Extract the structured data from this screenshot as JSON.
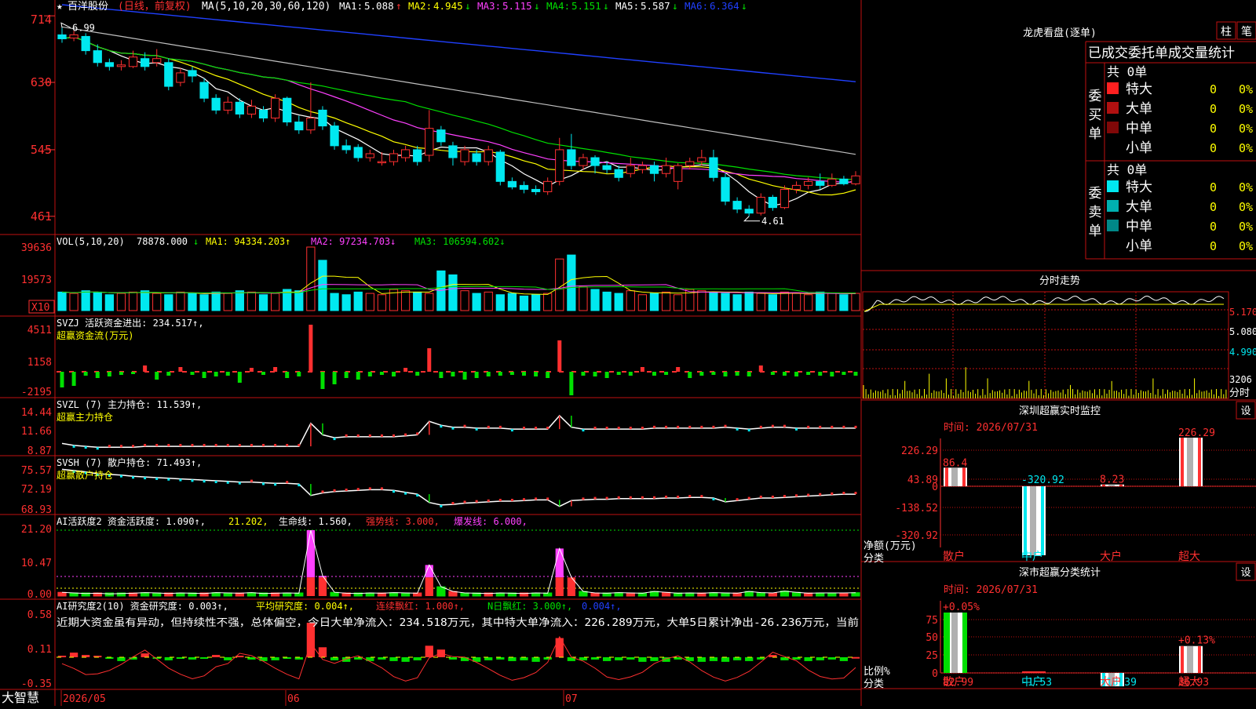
{
  "colors": {
    "bg": "#000000",
    "frame": "#c01010",
    "up": "#ff3030",
    "down": "#00e8f0",
    "ma1": "#ffffff",
    "ma2": "#ffff00",
    "ma3": "#ff40ff",
    "ma4": "#00e000",
    "ma5": "#c0c0c0",
    "ma6": "#2040ff",
    "green": "#00e000",
    "magenta": "#ff40ff",
    "yellow": "#ffff00",
    "text_white": "#ffffff",
    "axis_red": "#ff3030"
  },
  "app": {
    "logo_text": "大智慧",
    "date_axis": {
      "start_label": "2026/05",
      "mid_labels": [
        "06",
        "07"
      ]
    }
  },
  "price_panel": {
    "star": "★",
    "stock_name": "百洋股份",
    "period_label": "(日线，前复权)",
    "ma_prefix": "MA(5,10,20,30,60,120)",
    "ma_values": [
      {
        "label": "MA1:",
        "value": "5.088",
        "arrow": "↑",
        "color": "#ffffff"
      },
      {
        "label": "MA2:",
        "value": "4.945",
        "arrow": "↓",
        "color": "#ffff00"
      },
      {
        "label": "MA3:",
        "value": "5.115",
        "arrow": "↓",
        "color": "#ff40ff"
      },
      {
        "label": "MA4:",
        "value": "5.151",
        "arrow": "↓",
        "color": "#00e000"
      },
      {
        "label": "MA5:",
        "value": "5.587",
        "arrow": "↓",
        "color": "#ffffff"
      },
      {
        "label": "MA6:",
        "value": "6.364",
        "arrow": "↓",
        "color": "#2040ff"
      }
    ],
    "y_ticks": [
      "714",
      "630",
      "545",
      "461"
    ],
    "y_range": [
      4.4,
      7.3
    ],
    "high_marker": "6.99",
    "low_marker": "4.61"
  },
  "vol_panel": {
    "title": "VOL(5,10,20)",
    "main_value": "78878.000",
    "main_arrow": "↓",
    "ma1": "MA1: 94334.203↑",
    "ma2": "MA2: 97234.703↓",
    "ma3": "MA3: 106594.602↓",
    "y_ticks": [
      "39636",
      "19573"
    ],
    "unit": "X10"
  },
  "svzj_panel": {
    "title": "SVZJ  活跃资金进出: 234.517↑,",
    "subtitle": "超赢资金流(万元)",
    "y_ticks": [
      "4511",
      "1158",
      "-2195"
    ]
  },
  "svzl_panel": {
    "title": "SVZL (7) 主力持仓: 11.539↑,",
    "subtitle": "超赢主力持仓",
    "y_ticks": [
      "14.44",
      "11.66",
      "8.87"
    ]
  },
  "svsh_panel": {
    "title": "SVSH (7) 散户持仓: 71.493↑,",
    "subtitle": "超赢散户持仓",
    "y_ticks": [
      "75.57",
      "72.19",
      "68.93"
    ]
  },
  "ai_active_panel": {
    "title": "AI活跃度2 资金活跃度: 1.090↑,",
    "val_21": "21.202,",
    "life_line": "生命线: 1.560,",
    "strong_line": "强势线: 3.000,",
    "burst_line": "爆发线: 6.000,",
    "y_ticks": [
      "21.20",
      "10.47",
      "0.00"
    ]
  },
  "ai_research_panel": {
    "title": "AI研究度2(10) 资金研究度: 0.003↑,",
    "avg": "平均研究度: 0.004↑,",
    "streak": "连续飘红: 1.000↑,",
    "nday": "N日飘红: 3.000↑,",
    "extra": "0.004↑,",
    "comment": "近期大资金虽有异动，但持续性不强，总体偏空，今日大单净流入：234.518万元，其中特大单净流入：226.289万元，大单5日累计净出-26.236万元，当前",
    "y_ticks": [
      "0.58",
      "0.11",
      "-0.35"
    ]
  },
  "chart_data": [
    {
      "type": "candlestick",
      "title": "百洋股份 (日线，前复权)",
      "x_range": [
        "2026/05",
        "2026/07/31"
      ],
      "ylim": [
        4.4,
        7.3
      ],
      "candles": [
        [
          6.9,
          6.85,
          6.99,
          6.8
        ],
        [
          6.86,
          6.9,
          6.95,
          6.82
        ],
        [
          6.88,
          6.7,
          6.92,
          6.65
        ],
        [
          6.7,
          6.55,
          6.78,
          6.5
        ],
        [
          6.55,
          6.5,
          6.6,
          6.45
        ],
        [
          6.5,
          6.52,
          6.58,
          6.45
        ],
        [
          6.5,
          6.62,
          6.7,
          6.48
        ],
        [
          6.6,
          6.5,
          6.68,
          6.45
        ],
        [
          6.55,
          6.6,
          6.72,
          6.5
        ],
        [
          6.55,
          6.25,
          6.6,
          6.2
        ],
        [
          6.3,
          6.42,
          6.48,
          6.25
        ],
        [
          6.45,
          6.38,
          6.5,
          6.3
        ],
        [
          6.3,
          6.1,
          6.35,
          6.05
        ],
        [
          6.1,
          5.95,
          6.15,
          5.9
        ],
        [
          5.95,
          6.05,
          6.12,
          5.9
        ],
        [
          6.05,
          5.9,
          6.1,
          5.85
        ],
        [
          5.9,
          6.0,
          6.08,
          5.85
        ],
        [
          5.95,
          5.85,
          6.0,
          5.8
        ],
        [
          5.85,
          6.1,
          6.15,
          5.8
        ],
        [
          6.1,
          5.8,
          6.12,
          5.75
        ],
        [
          5.8,
          5.7,
          5.88,
          5.65
        ],
        [
          5.7,
          5.85,
          6.3,
          5.65
        ],
        [
          5.95,
          5.75,
          6.0,
          5.7
        ],
        [
          5.75,
          5.5,
          5.8,
          5.45
        ],
        [
          5.5,
          5.45,
          5.58,
          5.4
        ],
        [
          5.48,
          5.35,
          5.52,
          5.3
        ],
        [
          5.35,
          5.4,
          5.45,
          5.3
        ],
        [
          5.3,
          5.3,
          5.42,
          5.25
        ],
        [
          5.3,
          5.4,
          5.45,
          5.25
        ],
        [
          5.35,
          5.45,
          5.5,
          5.3
        ],
        [
          5.45,
          5.3,
          5.5,
          5.25
        ],
        [
          5.38,
          5.72,
          5.95,
          5.3
        ],
        [
          5.7,
          5.55,
          5.75,
          5.5
        ],
        [
          5.5,
          5.35,
          5.55,
          5.25
        ],
        [
          5.3,
          5.45,
          5.5,
          5.25
        ],
        [
          5.4,
          5.3,
          5.45,
          5.25
        ],
        [
          5.3,
          5.45,
          5.5,
          5.25
        ],
        [
          5.42,
          5.05,
          5.45,
          5.0
        ],
        [
          5.05,
          4.98,
          5.1,
          4.95
        ],
        [
          5.0,
          4.95,
          5.05,
          4.9
        ],
        [
          4.95,
          4.92,
          5.0,
          4.88
        ],
        [
          4.92,
          5.05,
          5.1,
          4.88
        ],
        [
          5.05,
          5.45,
          5.6,
          5.0
        ],
        [
          5.45,
          5.25,
          5.65,
          5.2
        ],
        [
          5.25,
          5.35,
          5.4,
          5.2
        ],
        [
          5.35,
          5.25,
          5.38,
          5.15
        ],
        [
          5.25,
          5.2,
          5.3,
          5.15
        ],
        [
          5.2,
          5.1,
          5.25,
          5.05
        ],
        [
          5.15,
          5.25,
          5.35,
          5.1
        ],
        [
          5.2,
          5.25,
          5.3,
          5.15
        ],
        [
          5.25,
          5.15,
          5.3,
          5.05
        ],
        [
          5.15,
          5.25,
          5.35,
          5.1
        ],
        [
          5.05,
          5.25,
          5.28,
          4.95
        ],
        [
          5.25,
          5.3,
          5.35,
          5.2
        ],
        [
          5.3,
          5.35,
          5.45,
          5.25
        ],
        [
          5.35,
          5.1,
          5.45,
          5.05
        ],
        [
          5.1,
          4.8,
          5.15,
          4.75
        ],
        [
          4.8,
          4.7,
          4.85,
          4.65
        ],
        [
          4.7,
          4.65,
          4.75,
          4.61
        ],
        [
          4.65,
          4.85,
          4.9,
          4.62
        ],
        [
          4.85,
          4.72,
          4.88,
          4.68
        ],
        [
          4.72,
          4.95,
          5.0,
          4.7
        ],
        [
          4.95,
          5.0,
          5.05,
          4.9
        ],
        [
          5.0,
          5.05,
          5.1,
          4.95
        ],
        [
          5.05,
          5.0,
          5.15,
          4.95
        ],
        [
          5.0,
          5.08,
          5.15,
          4.98
        ],
        [
          5.08,
          5.02,
          5.12,
          5.0
        ],
        [
          5.02,
          5.12,
          5.18,
          5.0
        ]
      ]
    },
    {
      "type": "bar",
      "title": "VOL(5,10,20)",
      "values": [
        14,
        13,
        15,
        14,
        12,
        13,
        14,
        15,
        13,
        12,
        14,
        13,
        12,
        14,
        13,
        15,
        14,
        12,
        13,
        16,
        15,
        48,
        38,
        13,
        12,
        14,
        13,
        12,
        16,
        15,
        14,
        13,
        30,
        27,
        15,
        13,
        14,
        12,
        13,
        11,
        12,
        13,
        39,
        42,
        18,
        16,
        14,
        13,
        15,
        12,
        13,
        14,
        12,
        16,
        15,
        14,
        13,
        12,
        14,
        13,
        12,
        14,
        13,
        12,
        14,
        13,
        12,
        13
      ]
    },
    {
      "type": "bar",
      "title": "SVZJ 活跃资金进出",
      "values": [
        -20,
        -18,
        -5,
        -8,
        -6,
        -4,
        -3,
        8,
        -10,
        -5,
        6,
        -4,
        -8,
        -6,
        -5,
        -14,
        5,
        -4,
        6,
        -8,
        -6,
        60,
        -22,
        -16,
        -8,
        -10,
        -6,
        -4,
        -6,
        5,
        -5,
        30,
        -8,
        -6,
        -10,
        -8,
        -6,
        -5,
        -4,
        -5,
        -6,
        -8,
        40,
        -30,
        -5,
        -6,
        -8,
        -4,
        -5,
        6,
        -5,
        -4,
        6,
        -8,
        -5,
        -4,
        -6,
        -5,
        -6,
        8,
        -4,
        -5,
        -6,
        -4,
        -5,
        -6,
        -4,
        -5
      ]
    },
    {
      "type": "line",
      "title": "SVZL 主力持仓",
      "ylim": [
        8.87,
        14.44
      ],
      "values": [
        9.9,
        9.7,
        9.6,
        9.5,
        9.5,
        9.5,
        9.5,
        9.6,
        9.6,
        9.6,
        9.6,
        9.6,
        9.6,
        9.6,
        9.6,
        9.6,
        9.6,
        9.6,
        9.6,
        9.6,
        9.6,
        12.0,
        10.8,
        10.5,
        10.6,
        10.6,
        10.6,
        10.6,
        10.6,
        10.7,
        10.8,
        12.2,
        11.8,
        11.6,
        11.6,
        11.5,
        11.5,
        11.5,
        11.4,
        11.4,
        11.4,
        11.4,
        12.8,
        11.6,
        11.4,
        11.4,
        11.4,
        11.4,
        11.4,
        11.4,
        11.5,
        11.5,
        11.5,
        11.5,
        11.5,
        11.5,
        11.6,
        11.5,
        11.4,
        11.5,
        11.6,
        11.6,
        11.5,
        11.5,
        11.5,
        11.5,
        11.5,
        11.5
      ]
    },
    {
      "type": "line",
      "title": "SVSH 散户持仓",
      "ylim": [
        68.93,
        75.57
      ],
      "values": [
        75.4,
        75.2,
        75.0,
        74.7,
        74.6,
        74.5,
        74.3,
        74.2,
        74.1,
        74.0,
        73.9,
        73.8,
        73.7,
        73.6,
        73.5,
        73.4,
        73.4,
        73.3,
        73.2,
        73.2,
        73.1,
        71.3,
        71.7,
        71.9,
        72.0,
        72.1,
        72.2,
        72.2,
        72.1,
        71.8,
        71.5,
        70.2,
        69.8,
        69.9,
        70.1,
        70.2,
        70.3,
        70.4,
        70.4,
        70.5,
        70.6,
        70.6,
        69.6,
        70.5,
        70.6,
        70.7,
        70.7,
        70.8,
        70.8,
        70.8,
        70.8,
        70.9,
        70.9,
        71.0,
        71.0,
        70.9,
        70.3,
        70.5,
        70.7,
        70.9,
        70.9,
        71.0,
        71.1,
        71.2,
        71.3,
        71.4,
        71.5,
        71.5
      ]
    },
    {
      "type": "bar",
      "title": "AI活跃度2",
      "ylim": [
        0,
        21.2
      ],
      "values": [
        1.2,
        1.0,
        0.8,
        0.9,
        0.7,
        0.8,
        0.9,
        1.1,
        1.0,
        0.8,
        1.0,
        0.9,
        0.8,
        1.1,
        1.0,
        0.9,
        1.1,
        0.8,
        0.9,
        1.0,
        0.9,
        21.2,
        6.5,
        1.2,
        0.9,
        0.8,
        1.0,
        0.9,
        1.1,
        1.0,
        0.9,
        10.0,
        3.0,
        1.5,
        1.0,
        0.9,
        0.8,
        1.0,
        0.9,
        0.8,
        1.0,
        0.9,
        15.3,
        6.0,
        1.5,
        1.0,
        0.9,
        1.1,
        1.0,
        0.9,
        1.5,
        1.2,
        0.9,
        1.0,
        0.9,
        1.1,
        1.0,
        0.9,
        1.5,
        1.1,
        1.0,
        1.6,
        1.2,
        0.9,
        1.0,
        1.0,
        1.0,
        1.09
      ]
    },
    {
      "type": "bar",
      "title": "AI研究度2",
      "ylim": [
        -0.35,
        0.58
      ],
      "values": [
        0.02,
        0.06,
        0.03,
        0.02,
        -0.02,
        -0.05,
        -0.03,
        0.05,
        -0.02,
        -0.04,
        -0.02,
        -0.03,
        -0.01,
        0.03,
        -0.04,
        0.02,
        -0.03,
        -0.05,
        -0.04,
        -0.02,
        -0.03,
        0.45,
        0.13,
        -0.04,
        -0.06,
        -0.03,
        -0.05,
        -0.03,
        -0.05,
        -0.06,
        -0.04,
        0.15,
        0.1,
        -0.03,
        -0.05,
        -0.06,
        -0.04,
        -0.03,
        -0.05,
        -0.04,
        -0.06,
        -0.03,
        0.25,
        -0.05,
        -0.04,
        -0.03,
        -0.05,
        -0.04,
        -0.03,
        -0.06,
        -0.05,
        -0.06,
        -0.03,
        -0.05,
        -0.06,
        -0.05,
        -0.06,
        -0.04,
        -0.05,
        -0.03,
        0.03,
        -0.04,
        -0.03,
        -0.05,
        -0.04,
        -0.03,
        -0.05,
        0.003
      ]
    },
    {
      "type": "bar",
      "title": "深圳超赢实时监控",
      "time": "时间: 2026/07/31",
      "categories": [
        "散户",
        "中户",
        "大户",
        "超大"
      ],
      "values": [
        86.4,
        -320.92,
        8.23,
        226.29
      ],
      "value_labels": [
        "86.4",
        "-320.92",
        "8.23",
        "226.29"
      ],
      "y_ticks": [
        "226.29",
        "43.89",
        "0",
        "-138.52",
        "-320.92"
      ],
      "ylim": [
        -320.92,
        226.29
      ],
      "ylabel": "净额(万元)",
      "xlabel": "分类"
    },
    {
      "type": "bar",
      "title": "深市超赢分类统计",
      "time": "时间: 2026/07/31",
      "categories": [
        "散户",
        "中户",
        "大户",
        "超大"
      ],
      "values": [
        82.99,
        -1.53,
        -18.39,
        36.93
      ],
      "value_labels": [
        "82.99",
        "-1.53",
        "-18.39",
        "36.93"
      ],
      "top_labels": [
        "+0.05%",
        "",
        "",
        "+0.13%"
      ],
      "y_ticks": [
        "75",
        "50",
        "25",
        "0"
      ],
      "ylim": [
        0,
        85
      ],
      "ylabel": "比例%",
      "xlabel": "分类"
    }
  ],
  "right_panel": {
    "lhb_title": "龙虎看盘(逐单)",
    "btn_column": "柱",
    "btn_pen": "笔",
    "order_header": "已成交委托单成交量统计",
    "buy_side_label": "委买单",
    "sell_side_label": "委卖单",
    "buy_total": "共 0单",
    "sell_total": "共 0单",
    "rows": [
      {
        "name": "特大",
        "count": "0",
        "pct": "0%"
      },
      {
        "name": "大单",
        "count": "0",
        "pct": "0%"
      },
      {
        "name": "中单",
        "count": "0",
        "pct": "0%"
      },
      {
        "name": "小单",
        "count": "0",
        "pct": "0%"
      }
    ],
    "buy_colors": [
      "#ff2020",
      "#b01010",
      "#800808",
      "#000000"
    ],
    "sell_colors": [
      "#00e8f0",
      "#00b0b0",
      "#008888",
      "#000000"
    ],
    "intraday_title": "分时走势",
    "intraday_ticks": [
      "5.170",
      "5.080",
      "4.990"
    ],
    "intraday_vol_label": "3206",
    "intraday_vol_unit": "分时",
    "sz_title": "深圳超赢实时监控",
    "sz_setting": "设",
    "szclass_title": "深市超赢分类统计",
    "szclass_setting": "设"
  }
}
